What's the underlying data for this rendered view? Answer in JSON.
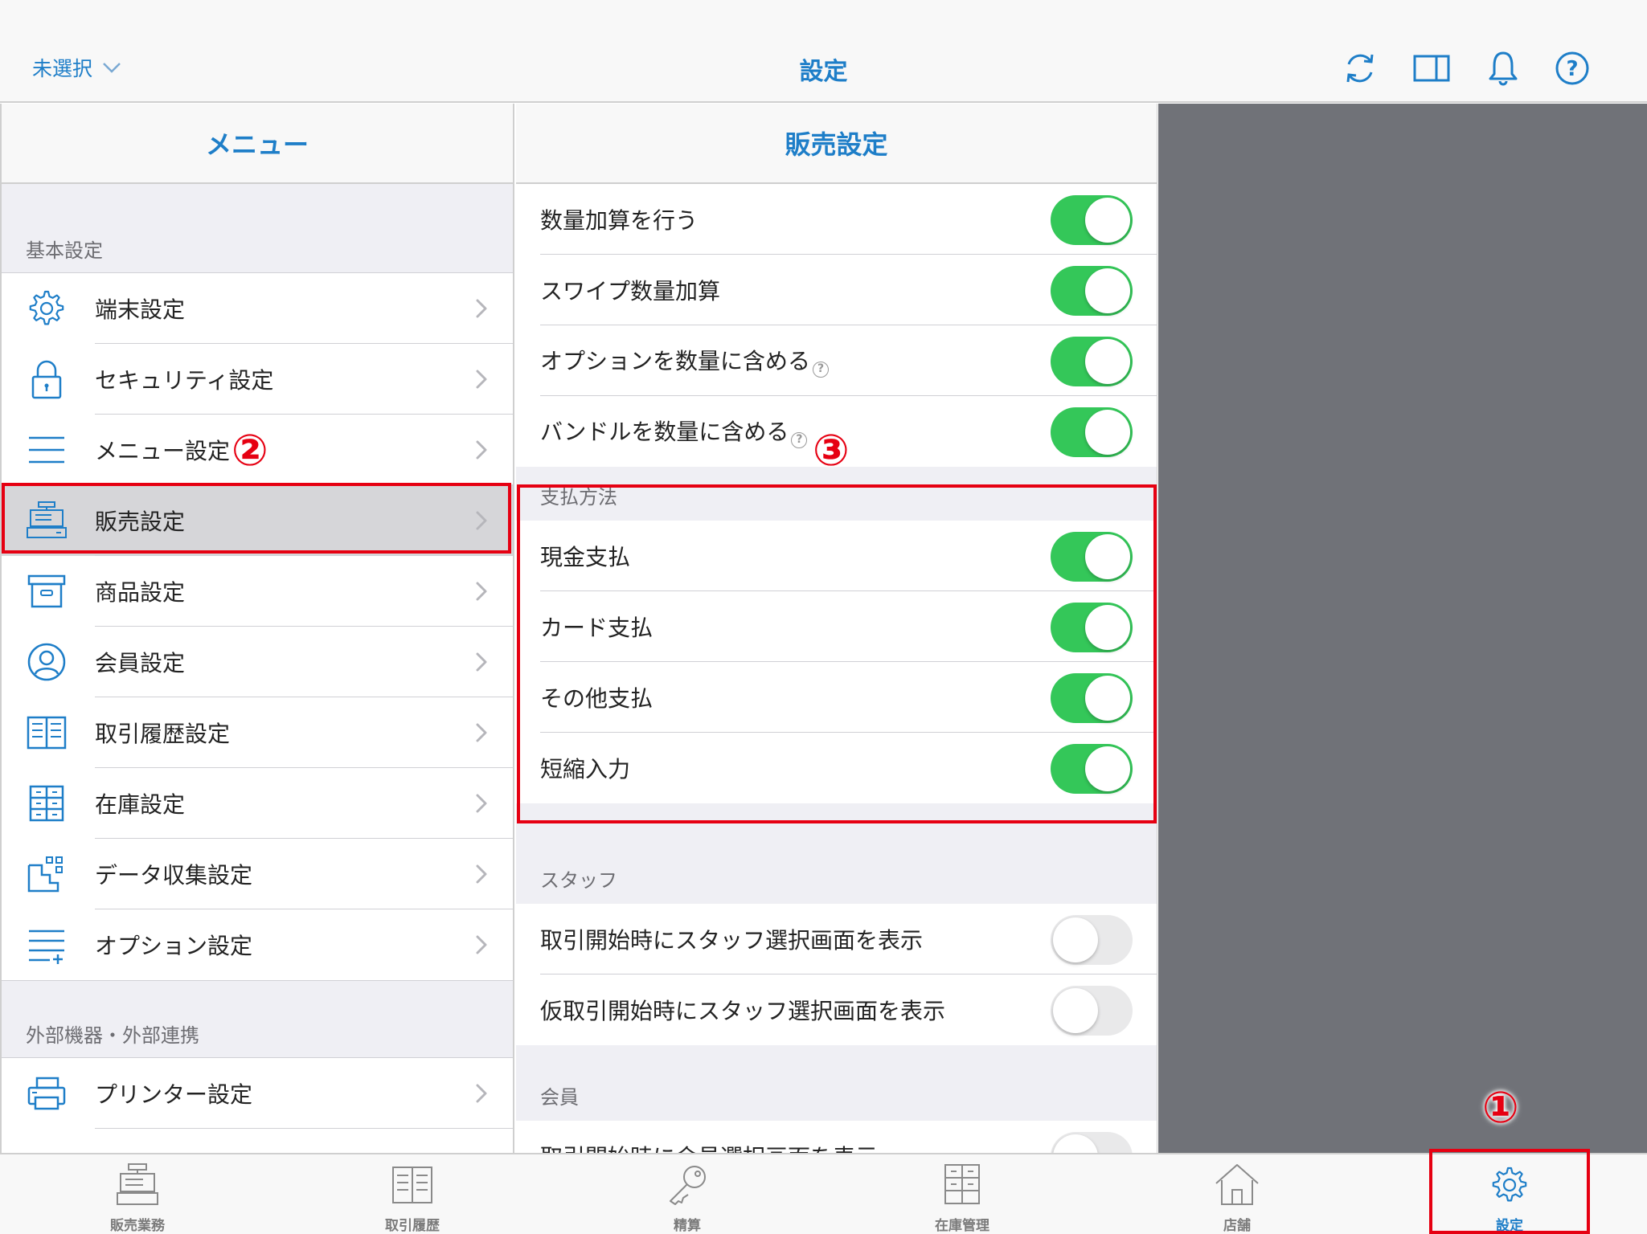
{
  "header": {
    "selector_label": "未選択",
    "title": "設定",
    "icons": [
      "sync-icon",
      "split-view-icon",
      "bell-icon",
      "help-icon"
    ]
  },
  "menu": {
    "title": "メニュー",
    "section_basic": "基本設定",
    "items": [
      {
        "label": "端末設定",
        "icon": "gear-icon"
      },
      {
        "label": "セキュリティ設定",
        "icon": "lock-icon"
      },
      {
        "label": "メニュー設定",
        "icon": "menu-lines-icon"
      },
      {
        "label": "販売設定",
        "icon": "register-icon"
      },
      {
        "label": "商品設定",
        "icon": "box-icon"
      },
      {
        "label": "会員設定",
        "icon": "person-icon"
      },
      {
        "label": "取引履歴設定",
        "icon": "book-icon"
      },
      {
        "label": "在庫設定",
        "icon": "cabinet-icon"
      },
      {
        "label": "データ収集設定",
        "icon": "data-icon"
      },
      {
        "label": "オプション設定",
        "icon": "options-icon"
      }
    ],
    "section_external": "外部機器・外部連携",
    "external_items": [
      {
        "label": "プリンター設定",
        "icon": "printer-icon"
      }
    ]
  },
  "sales": {
    "title": "販売設定",
    "rows": [
      {
        "label": "数量加算を行う",
        "on": true
      },
      {
        "label": "スワイプ数量加算",
        "on": true
      },
      {
        "label": "オプションを数量に含める",
        "on": true
      },
      {
        "label": "バンドルを数量に含める",
        "on": true
      }
    ],
    "help_glyph": "?",
    "payment_header": "支払方法",
    "payment_rows": [
      {
        "label": "現金支払",
        "on": true
      },
      {
        "label": "カード支払",
        "on": true
      },
      {
        "label": "その他支払",
        "on": true
      },
      {
        "label": "短縮入力",
        "on": true
      }
    ],
    "staff_header": "スタッフ",
    "staff_rows": [
      {
        "label": "取引開始時にスタッフ選択画面を表示",
        "on": false
      },
      {
        "label": "仮取引開始時にスタッフ選択画面を表示",
        "on": false
      }
    ],
    "member_header": "会員",
    "member_rows": [
      {
        "label": "取引開始時に会員選択画面を表示",
        "on": false
      }
    ]
  },
  "tabbar": {
    "tabs": [
      {
        "label": "販売業務",
        "icon": "register-icon"
      },
      {
        "label": "取引履歴",
        "icon": "book-icon"
      },
      {
        "label": "精算",
        "icon": "key-icon"
      },
      {
        "label": "在庫管理",
        "icon": "cabinet-icon"
      },
      {
        "label": "店舗",
        "icon": "house-icon"
      },
      {
        "label": "設定",
        "icon": "gear-icon"
      }
    ]
  },
  "annotations": {
    "badge1": "①",
    "badge2": "②",
    "badge3": "③"
  },
  "colors": {
    "accent": "#1e7ec8",
    "toggle_on": "#34c759",
    "annotation_red": "#e60012"
  }
}
